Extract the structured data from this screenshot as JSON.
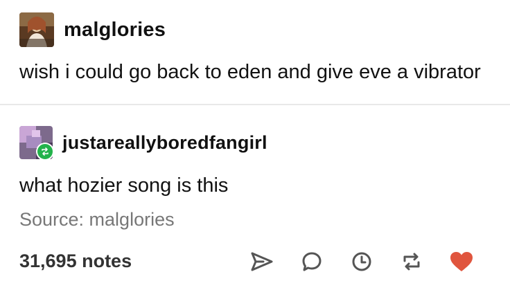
{
  "original_post": {
    "username": "malglories",
    "text": "wish i could go back to eden and give eve a vibrator"
  },
  "reblog": {
    "username": "justareallyboredfangirl",
    "text": "what hozier song is this",
    "badge_icon": "reblog-badge-icon",
    "badge_color": "#23b24b"
  },
  "source": {
    "label": "Source: malglories"
  },
  "footer": {
    "notes": "31,695 notes",
    "actions": [
      {
        "name": "share-icon"
      },
      {
        "name": "reply-icon"
      },
      {
        "name": "queue-icon"
      },
      {
        "name": "reblog-icon"
      },
      {
        "name": "like-icon",
        "color": "#e0553e"
      }
    ]
  }
}
